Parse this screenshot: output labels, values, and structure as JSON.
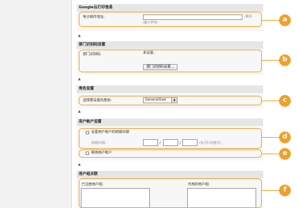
{
  "google_cloud": {
    "title": "Google云打印信息",
    "email_label": "电子邮件地址:",
    "email_value": "",
    "email_suffix": "(最多",
    "email_hint": "(最小字符)"
  },
  "dept_id": {
    "title": "部门识别码设置",
    "label": "部门识别码:",
    "value": "未设置。",
    "button_label": "部门识别码设置..."
  },
  "role": {
    "title": "角色设置",
    "label": "选择要设置的角色:",
    "selected": "GeneralUser"
  },
  "user_account": {
    "title": "用户帐户设置",
    "expiry_checkbox_label": "设置用户帐户的到期日期",
    "expiry_date_label": "到期日期:",
    "date_separator": "/",
    "date_note": "(年/月/日格式)",
    "disable_checkbox_label": "禁用用户帐户"
  },
  "user_group": {
    "title": "用户组关联",
    "registered_label": "已注册用户组:",
    "available_label": "可用的用户组:"
  },
  "callouts": [
    "a",
    "b",
    "c",
    "d",
    "e",
    "f"
  ],
  "colors": {
    "accent": "#f0a028"
  }
}
